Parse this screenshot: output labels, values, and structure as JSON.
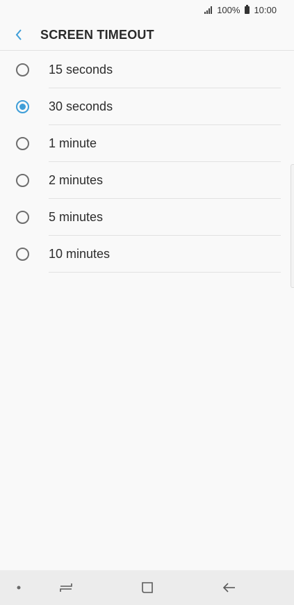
{
  "status_bar": {
    "battery": "100%",
    "time": "10:00"
  },
  "header": {
    "title": "SCREEN TIMEOUT"
  },
  "options": [
    {
      "label": "15 seconds",
      "selected": false
    },
    {
      "label": "30 seconds",
      "selected": true
    },
    {
      "label": "1 minute",
      "selected": false
    },
    {
      "label": "2 minutes",
      "selected": false
    },
    {
      "label": "5 minutes",
      "selected": false
    },
    {
      "label": "10 minutes",
      "selected": false
    }
  ],
  "colors": {
    "accent": "#3e9ed8",
    "background": "#f9f9f9",
    "nav_bar": "#ececec"
  },
  "nav_bar": {
    "icons": [
      "dot-icon",
      "recent-apps-icon",
      "home-icon",
      "back-icon"
    ]
  }
}
